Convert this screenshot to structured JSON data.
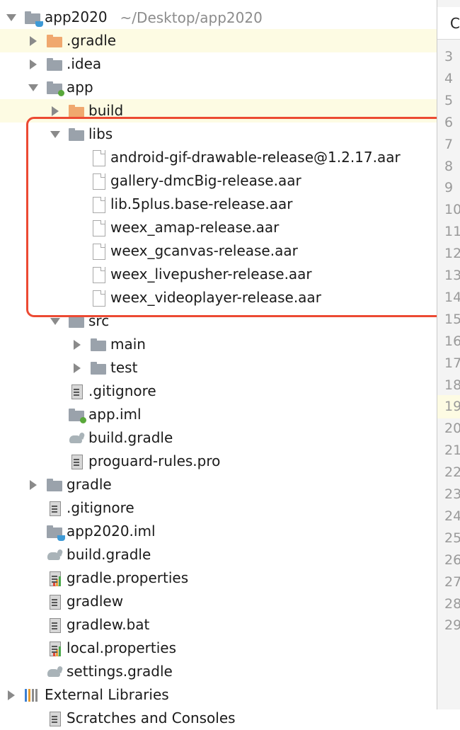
{
  "tree": [
    {
      "label": "app2020",
      "path": "~/Desktop/app2020",
      "depth": 0,
      "arrow": "open",
      "icon": "folder-module",
      "highlight": false
    },
    {
      "label": ".gradle",
      "depth": 1,
      "arrow": "closed",
      "icon": "folder-orange",
      "highlight": true
    },
    {
      "label": ".idea",
      "depth": 1,
      "arrow": "closed",
      "icon": "folder",
      "highlight": false
    },
    {
      "label": "app",
      "depth": 1,
      "arrow": "open",
      "icon": "folder-app",
      "highlight": false
    },
    {
      "label": "build",
      "depth": 2,
      "arrow": "closed",
      "icon": "folder-orange",
      "highlight": true
    },
    {
      "label": "libs",
      "depth": 2,
      "arrow": "open",
      "icon": "folder",
      "highlight": false
    },
    {
      "label": "android-gif-drawable-release@1.2.17.aar",
      "depth": 3,
      "arrow": "none",
      "icon": "file",
      "highlight": false
    },
    {
      "label": "gallery-dmcBig-release.aar",
      "depth": 3,
      "arrow": "none",
      "icon": "file",
      "highlight": false
    },
    {
      "label": "lib.5plus.base-release.aar",
      "depth": 3,
      "arrow": "none",
      "icon": "file",
      "highlight": false
    },
    {
      "label": "weex_amap-release.aar",
      "depth": 3,
      "arrow": "none",
      "icon": "file",
      "highlight": false
    },
    {
      "label": "weex_gcanvas-release.aar",
      "depth": 3,
      "arrow": "none",
      "icon": "file",
      "highlight": false
    },
    {
      "label": "weex_livepusher-release.aar",
      "depth": 3,
      "arrow": "none",
      "icon": "file",
      "highlight": false
    },
    {
      "label": "weex_videoplayer-release.aar",
      "depth": 3,
      "arrow": "none",
      "icon": "file",
      "highlight": false
    },
    {
      "label": "src",
      "depth": 2,
      "arrow": "open",
      "icon": "folder",
      "highlight": false
    },
    {
      "label": "main",
      "depth": 3,
      "arrow": "closed",
      "icon": "folder",
      "highlight": false
    },
    {
      "label": "test",
      "depth": 3,
      "arrow": "closed",
      "icon": "folder",
      "highlight": false
    },
    {
      "label": ".gitignore",
      "depth": 2,
      "arrow": "none",
      "icon": "text-file",
      "highlight": false
    },
    {
      "label": "app.iml",
      "depth": 2,
      "arrow": "none",
      "icon": "folder-app",
      "highlight": false
    },
    {
      "label": "build.gradle",
      "depth": 2,
      "arrow": "none",
      "icon": "gradle",
      "highlight": false
    },
    {
      "label": "proguard-rules.pro",
      "depth": 2,
      "arrow": "none",
      "icon": "text-file",
      "highlight": false
    },
    {
      "label": "gradle",
      "depth": 1,
      "arrow": "closed",
      "icon": "folder",
      "highlight": false
    },
    {
      "label": ".gitignore",
      "depth": 1,
      "arrow": "none",
      "icon": "text-file",
      "highlight": false
    },
    {
      "label": "app2020.iml",
      "depth": 1,
      "arrow": "none",
      "icon": "folder-module",
      "highlight": false
    },
    {
      "label": "build.gradle",
      "depth": 1,
      "arrow": "none",
      "icon": "gradle",
      "highlight": false
    },
    {
      "label": "gradle.properties",
      "depth": 1,
      "arrow": "none",
      "icon": "properties-file",
      "highlight": false
    },
    {
      "label": "gradlew",
      "depth": 1,
      "arrow": "none",
      "icon": "text-file",
      "highlight": false
    },
    {
      "label": "gradlew.bat",
      "depth": 1,
      "arrow": "none",
      "icon": "text-file",
      "highlight": false
    },
    {
      "label": "local.properties",
      "depth": 1,
      "arrow": "none",
      "icon": "properties-file",
      "highlight": false
    },
    {
      "label": "settings.gradle",
      "depth": 1,
      "arrow": "none",
      "icon": "gradle",
      "highlight": false
    },
    {
      "label": "External Libraries",
      "depth": 0,
      "arrow": "closed",
      "icon": "external-libraries",
      "highlight": false
    },
    {
      "label": "Scratches and Consoles",
      "depth": 1,
      "arrow": "none",
      "icon": "scratches",
      "highlight": false
    }
  ],
  "gutter": {
    "tab_label": "C",
    "line_numbers": [
      "3",
      "4",
      "5",
      "6",
      "7",
      "8",
      "9",
      "10",
      "11",
      "12",
      "13",
      "14",
      "15",
      "16",
      "17",
      "18",
      "19",
      "20",
      "21",
      "22",
      "23",
      "24",
      "25",
      "26",
      "27",
      "28",
      "29"
    ],
    "highlight_line": "19"
  },
  "colors": {
    "highlight_box": "#ec4a33",
    "row_highlight": "#fdfbe3",
    "folder": "#9aa2ab",
    "folder_orange": "#f0a86e"
  }
}
